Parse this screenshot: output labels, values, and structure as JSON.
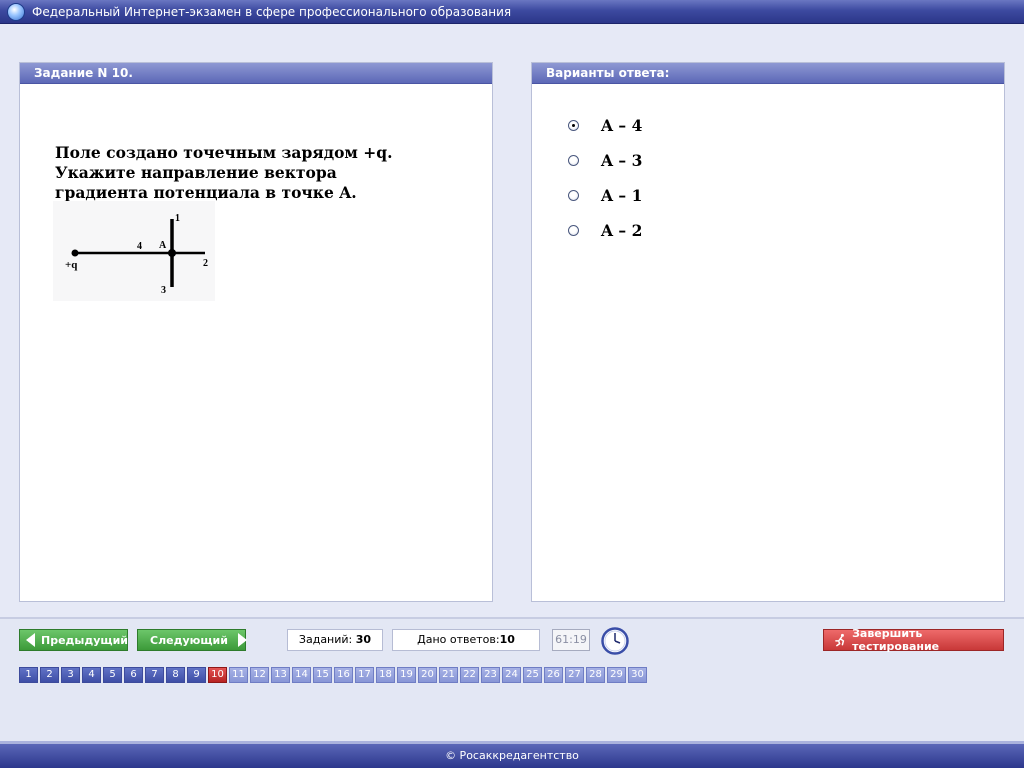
{
  "window": {
    "title": "Федеральный Интернет-экзамен в сфере профессионального образования"
  },
  "task": {
    "header": "Задание N 10.",
    "question": "Поле создано точечным зарядом +q. Укажите направление вектора градиента потенциала в точке A.",
    "figure": {
      "charge_label": "+q",
      "point_label": "A",
      "labels": [
        "1",
        "2",
        "3",
        "4"
      ]
    }
  },
  "answers": {
    "header": "Варианты ответа:",
    "selected_index": 0,
    "options": [
      "A – 4",
      "A – 3",
      "A – 1",
      "A – 2"
    ]
  },
  "nav": {
    "prev_label": "Предыдущий",
    "next_label": "Следующий"
  },
  "stats": {
    "tasks_label": "Заданий:",
    "tasks_value": "30",
    "answered_label": "Дано ответов:",
    "answered_value": "10",
    "timer": "61:19"
  },
  "finish_label": "Завершить тестирование",
  "pager": {
    "pages": [
      "1",
      "2",
      "3",
      "4",
      "5",
      "6",
      "7",
      "8",
      "9",
      "10",
      "11",
      "12",
      "13",
      "14",
      "15",
      "16",
      "17",
      "18",
      "19",
      "20",
      "21",
      "22",
      "23",
      "24",
      "25",
      "26",
      "27",
      "28",
      "29",
      "30"
    ],
    "current": "10"
  },
  "footer": "© Росаккредагентство",
  "colors": {
    "titlebar": "#3d4aa0",
    "panel_header": "#5c68b7",
    "nav_button": "#3c9a39",
    "finish_button": "#c83838",
    "current_page": "#b72222",
    "background": "#e6e9f6"
  }
}
